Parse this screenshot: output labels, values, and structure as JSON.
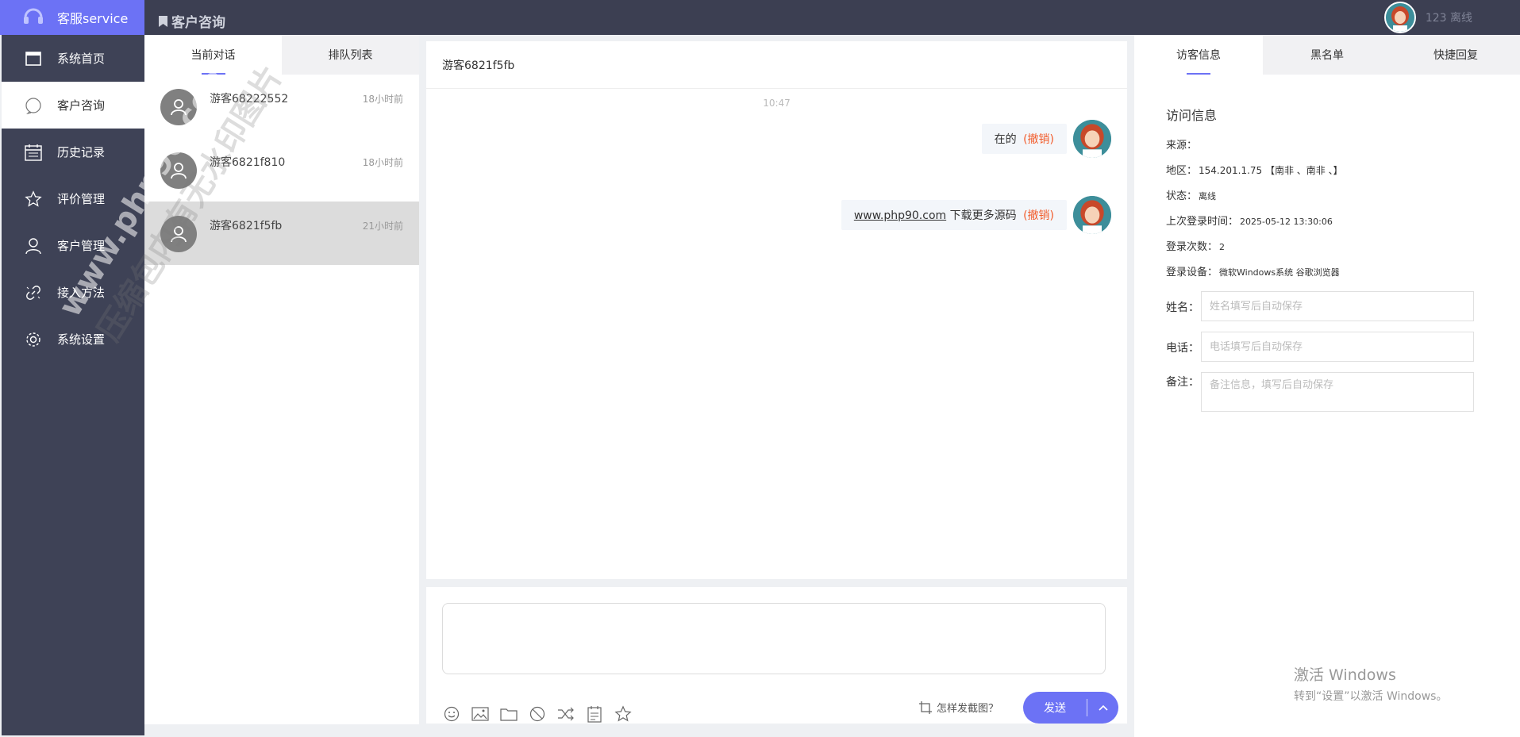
{
  "brand": {
    "title": "客服service"
  },
  "header": {
    "title": "客户咨询",
    "user_label": "123 离线"
  },
  "sidebar": {
    "items": [
      {
        "label": "系统首页",
        "icon": "window-icon"
      },
      {
        "label": "客户咨询",
        "icon": "chat-bubble-icon",
        "active": true
      },
      {
        "label": "历史记录",
        "icon": "history-icon"
      },
      {
        "label": "评价管理",
        "icon": "star-icon"
      },
      {
        "label": "客户管理",
        "icon": "user-icon"
      },
      {
        "label": "接入方法",
        "icon": "link-icon"
      },
      {
        "label": "系统设置",
        "icon": "gear-icon"
      }
    ]
  },
  "conv_panel": {
    "tabs": [
      "当前对话",
      "排队列表"
    ],
    "items": [
      {
        "name": "游客68222552",
        "time": "18小时前"
      },
      {
        "name": "游客6821f810",
        "time": "18小时前"
      },
      {
        "name": "游客6821f5fb",
        "time": "21小时前",
        "selected": true
      }
    ]
  },
  "chat": {
    "title": "游客6821f5fb",
    "time": "10:47",
    "messages": [
      {
        "text": "在的",
        "recall": "(撤销)"
      },
      {
        "link": "www.php90.com",
        "text": " 下载更多源码",
        "recall": "(撤销)"
      }
    ]
  },
  "composer": {
    "help": "怎样发截图？",
    "send_label": "发送"
  },
  "right_panel": {
    "tabs": [
      "访客信息",
      "黑名单",
      "快捷回复"
    ],
    "info_title": "访问信息",
    "rows": [
      {
        "label": "来源：",
        "value": ""
      },
      {
        "label": "地区：",
        "value": "154.201.1.75 【南非 、南非 、】"
      },
      {
        "label": "状态：",
        "value": "离线"
      },
      {
        "label": "上次登录时间：",
        "value": "2025-05-12 13:30:06"
      },
      {
        "label": "登录次数：",
        "value": "2"
      },
      {
        "label": "登录设备：",
        "value": "微软Windows系统 谷歌浏览器"
      }
    ],
    "fields": {
      "name_label": "姓名：",
      "name_placeholder": "姓名填写后自动保存",
      "phone_label": "电话：",
      "phone_placeholder": "电话填写后自动保存",
      "note_label": "备注：",
      "note_placeholder": "备注信息，填写后自动保存"
    }
  },
  "windows_watermark": {
    "line1": "激活 Windows",
    "line2": "转到“设置”以激活 Windows。"
  },
  "image_watermark": {
    "line1": "www.php90.com",
    "line2": "压缩包内有无水印图片"
  },
  "colors": {
    "accent": "#6c72f5",
    "sidebar": "#3e4256",
    "topbar": "#3c3f52",
    "recall": "#f25c2b"
  }
}
